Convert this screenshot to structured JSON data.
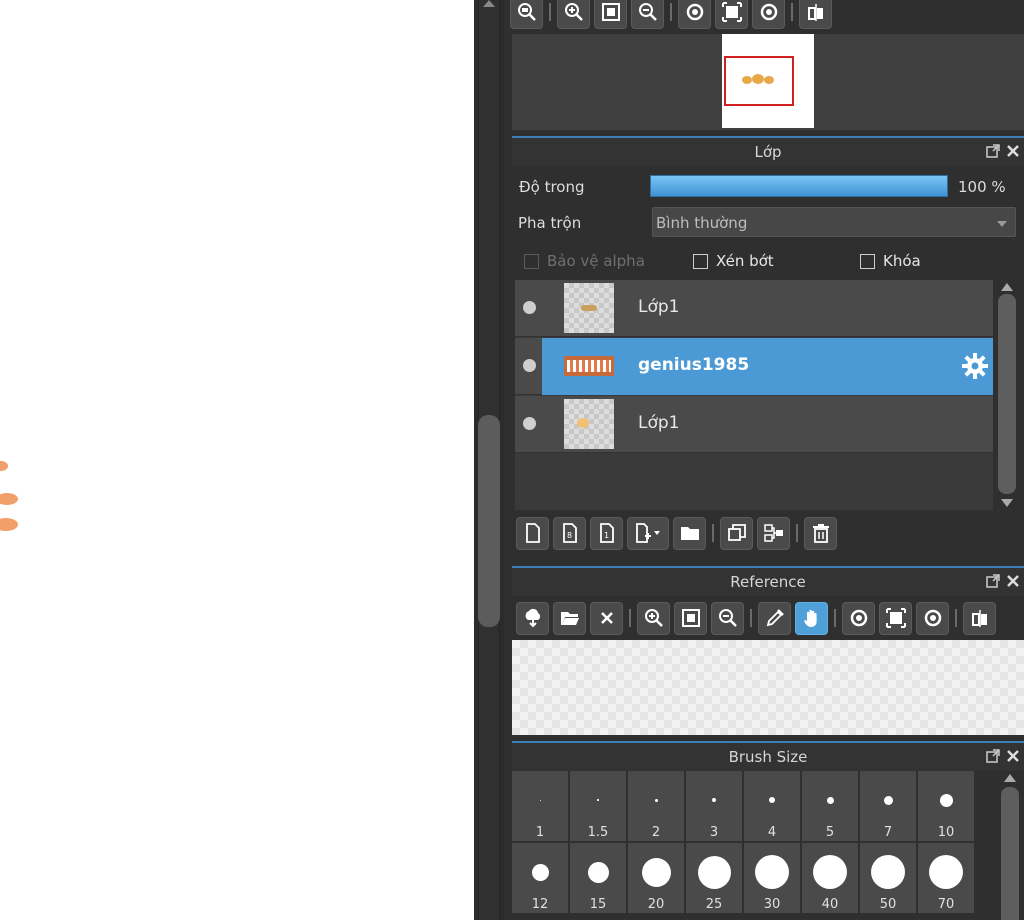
{
  "navigator": {
    "toolbar_icons": [
      "zoom-fit-icon",
      "zoom-in-icon",
      "fit-screen-icon",
      "zoom-out-icon",
      "rotate-left-icon",
      "actual-size-icon",
      "rotate-right-icon",
      "flip-icon"
    ]
  },
  "layer_panel": {
    "title": "Lớp",
    "opacity_label": "Độ trong",
    "opacity_value": "100 %",
    "opacity_percent": 100,
    "blend_label": "Pha trộn",
    "blend_value": "Bình thường",
    "protect_alpha_label": "Bảo vệ alpha",
    "clipping_label": "Xén bớt",
    "lock_label": "Khóa",
    "layers": [
      {
        "name": "Lớp1",
        "selected": false
      },
      {
        "name": "genius1985",
        "selected": true
      },
      {
        "name": "Lớp1",
        "selected": false
      }
    ],
    "toolbar_icons": [
      "new-layer-icon",
      "new-halftone-layer-icon",
      "new-1bit-layer-icon",
      "add-layer-menu-icon",
      "new-folder-icon",
      "duplicate-layer-icon",
      "merge-layer-icon",
      "delete-layer-icon"
    ]
  },
  "reference_panel": {
    "title": "Reference",
    "toolbar_icons": [
      "import-icon",
      "open-folder-icon",
      "close-icon",
      "zoom-in-icon",
      "fit-screen-icon",
      "zoom-out-icon",
      "eyedropper-icon",
      "hand-icon",
      "rotate-left-icon",
      "actual-size-icon",
      "rotate-right-icon",
      "flip-icon"
    ]
  },
  "brush_size_panel": {
    "title": "Brush Size",
    "sizes": [
      "1",
      "1.5",
      "2",
      "3",
      "4",
      "5",
      "7",
      "10",
      "12",
      "15",
      "20",
      "25",
      "30",
      "40",
      "50",
      "70"
    ]
  },
  "colors": {
    "accent": "#4b9ad6",
    "panel_bg": "#2f2f2f",
    "petal": "#f2a06a",
    "selection_rect": "#d02020"
  }
}
